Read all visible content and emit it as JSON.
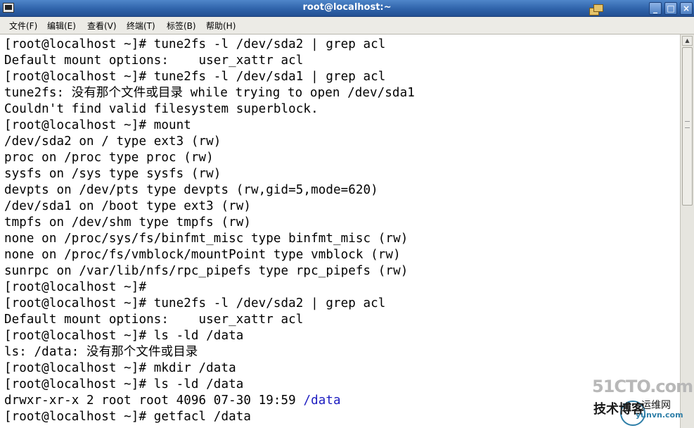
{
  "window": {
    "title": "root@localhost:~",
    "buttons": {
      "minimize": "_",
      "maximize": "□",
      "close": "×"
    }
  },
  "menubar": {
    "items": [
      "文件(F)",
      "编辑(E)",
      "查看(V)",
      "终端(T)",
      "标签(B)",
      "帮助(H)"
    ]
  },
  "terminal": {
    "lines": [
      "[root@localhost ~]# tune2fs -l /dev/sda2 | grep acl",
      "Default mount options:    user_xattr acl",
      "[root@localhost ~]# tune2fs -l /dev/sda1 | grep acl",
      "tune2fs: 没有那个文件或目录 while trying to open /dev/sda1",
      "Couldn't find valid filesystem superblock.",
      "[root@localhost ~]# mount",
      "/dev/sda2 on / type ext3 (rw)",
      "proc on /proc type proc (rw)",
      "sysfs on /sys type sysfs (rw)",
      "devpts on /dev/pts type devpts (rw,gid=5,mode=620)",
      "/dev/sda1 on /boot type ext3 (rw)",
      "tmpfs on /dev/shm type tmpfs (rw)",
      "none on /proc/sys/fs/binfmt_misc type binfmt_misc (rw)",
      "none on /proc/fs/vmblock/mountPoint type vmblock (rw)",
      "sunrpc on /var/lib/nfs/rpc_pipefs type rpc_pipefs (rw)",
      "[root@localhost ~]#",
      "[root@localhost ~]# tune2fs -l /dev/sda2 | grep acl",
      "Default mount options:    user_xattr acl",
      "[root@localhost ~]# ls -ld /data",
      "ls: /data: 没有那个文件或目录",
      "[root@localhost ~]# mkdir /data",
      "[root@localhost ~]# ls -ld /data",
      "drwxr-xr-x 2 root root 4096 07-30 19:59 ",
      "[root@localhost ~]# getfacl /data"
    ],
    "ls_dir_name": "/data",
    "dir_color": "#1c1cc0"
  },
  "watermark": {
    "site": "51CTO.com",
    "tagline": "技术博客",
    "brand": "运维网",
    "url": "yunvn.com"
  },
  "colors": {
    "titlebar": "#2f63aa",
    "menubar": "#ecebe6",
    "terminal_bg": "#ffffff",
    "terminal_fg": "#000000"
  }
}
